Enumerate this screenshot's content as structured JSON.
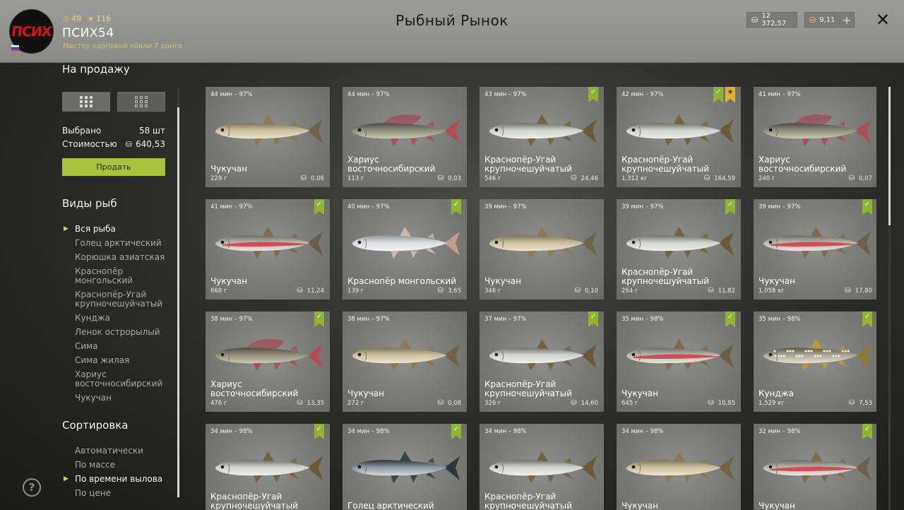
{
  "header": {
    "avatar_text": "ПСИХ",
    "level": "49",
    "stars": "116",
    "username": "ПСИХ54",
    "rank": "Мастер карповой ловли 7 ранга",
    "title": "Рыбный Рынок",
    "silver": "12 372,57",
    "gold": "9,11"
  },
  "sidebar": {
    "for_sale": "На продажу",
    "selected_label": "Выбрано",
    "selected_value": "58 шт",
    "cost_label": "Стоимостью",
    "cost_value": "640,53",
    "sell_button": "Продать",
    "species_title": "Виды рыб",
    "species": [
      "Вся рыба",
      "Голец арктический",
      "Корюшка азиатская",
      "Краснопёр монгольский",
      "Краснопёр-Угай крупночешуйчатый",
      "Кунджа",
      "Ленок острорылый",
      "Сима",
      "Сима жилая",
      "Хариус восточносибирский",
      "Чукучан"
    ],
    "active_species": 0,
    "sort_title": "Сортировка",
    "sort_options": [
      "Автоматически",
      "По массе",
      "По времени вылова",
      "По цене"
    ],
    "active_sort": 2
  },
  "colors": {
    "accent_green": "#a8c43c",
    "badge_check": "#8fb52e",
    "badge_star": "#e2b22a",
    "active_marker": "#d8d24a"
  },
  "cards": [
    {
      "time": "44 мин – 97%",
      "name": "Чукучан",
      "weight": "229 г",
      "price": "0,06",
      "fish": "sucker",
      "badges": []
    },
    {
      "time": "44 мин – 97%",
      "name": "Хариус восточносибирский",
      "weight": "113 г",
      "price": "0,03",
      "fish": "grayling",
      "badges": []
    },
    {
      "time": "43 мин – 97%",
      "name": "Краснопёр-Угай крупночешуйчатый",
      "weight": "546 г",
      "price": "24,46",
      "fish": "dace",
      "badges": [
        "check"
      ]
    },
    {
      "time": "42 мин – 97%",
      "name": "Краснопёр-Угай крупночешуйчатый",
      "weight": "1,312 кг",
      "price": "164,59",
      "fish": "dace",
      "badges": [
        "check",
        "star"
      ]
    },
    {
      "time": "41 мин – 97%",
      "name": "Хариус восточносибирский",
      "weight": "240 г",
      "price": "0,07",
      "fish": "grayling",
      "badges": []
    },
    {
      "time": "41 мин – 97%",
      "name": "Чукучан",
      "weight": "668 г",
      "price": "11,24",
      "fish": "sucker-red",
      "badges": [
        "check"
      ]
    },
    {
      "time": "40 мин – 97%",
      "name": "Краснопёр монгольский",
      "weight": "139 г",
      "price": "3,65",
      "fish": "silver",
      "badges": [
        "check"
      ]
    },
    {
      "time": "39 мин – 97%",
      "name": "Чукучан",
      "weight": "346 г",
      "price": "0,10",
      "fish": "sucker",
      "badges": []
    },
    {
      "time": "39 мин – 97%",
      "name": "Краснопёр-Угай крупночешуйчатый",
      "weight": "264 г",
      "price": "11,82",
      "fish": "dace",
      "badges": [
        "check"
      ]
    },
    {
      "time": "39 мин – 97%",
      "name": "Чукучан",
      "weight": "1,058 кг",
      "price": "17,80",
      "fish": "sucker-red",
      "badges": [
        "check"
      ]
    },
    {
      "time": "38 мин – 97%",
      "name": "Хариус восточносибирский",
      "weight": "476 г",
      "price": "13,35",
      "fish": "grayling",
      "badges": [
        "check"
      ]
    },
    {
      "time": "38 мин – 97%",
      "name": "Чукучан",
      "weight": "272 г",
      "price": "0,08",
      "fish": "sucker",
      "badges": []
    },
    {
      "time": "37 мин – 97%",
      "name": "Краснопёр-Угай крупночешуйчатый",
      "weight": "326 г",
      "price": "14,60",
      "fish": "dace",
      "badges": [
        "check"
      ]
    },
    {
      "time": "35 мин – 98%",
      "name": "Чукучан",
      "weight": "645 г",
      "price": "10,85",
      "fish": "sucker-red",
      "badges": [
        "check"
      ]
    },
    {
      "time": "35 мин – 98%",
      "name": "Кунджа",
      "weight": "1,529 кг",
      "price": "7,53",
      "fish": "char",
      "badges": [
        "check"
      ]
    },
    {
      "time": "34 мин – 98%",
      "name": "Краснопёр-Угай крупночешуйчатый",
      "weight": "",
      "price": "",
      "fish": "dace",
      "badges": [
        "check"
      ]
    },
    {
      "time": "34 мин – 98%",
      "name": "Голец арктический",
      "weight": "",
      "price": "",
      "fish": "trout",
      "badges": [
        "check"
      ]
    },
    {
      "time": "34 мин – 98%",
      "name": "Краснопёр-Угай крупночешуйчатый",
      "weight": "",
      "price": "",
      "fish": "dace",
      "badges": []
    },
    {
      "time": "34 мин – 98%",
      "name": "Чукучан",
      "weight": "",
      "price": "",
      "fish": "sucker",
      "badges": []
    },
    {
      "time": "32 мин – 98%",
      "name": "Чукучан",
      "weight": "",
      "price": "",
      "fish": "sucker-red",
      "badges": [
        "check"
      ]
    }
  ]
}
